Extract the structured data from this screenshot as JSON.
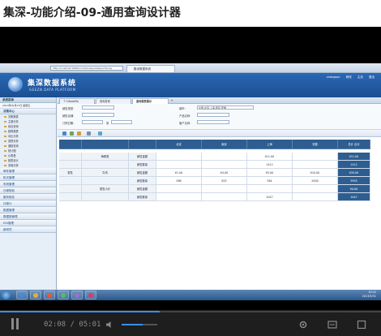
{
  "page": {
    "title": "集深-功能介绍-09-通用查询设计器"
  },
  "browser": {
    "address": "http://localhost:9000/modelAnalysis/ReportAnaly",
    "tab_label": "集深数据系统"
  },
  "app": {
    "logo_text": "集深数据系统",
    "logo_sub": "GEEZN DATA PLATFORM",
    "header_links": [
      "zhangsan",
      "修改",
      "主页",
      "退出"
    ]
  },
  "sidebar": {
    "header": "系统菜单",
    "date": "2013年05月27日 星期五",
    "section": "决策中心",
    "items": [
      "决策报表",
      "主题分析",
      "综合查询",
      "趋势报表",
      "对比分析",
      "透视分析",
      "通用查询",
      "统计图",
      "仪表盘",
      "报表设计",
      "多维分析"
    ],
    "menus": [
      "邮件管理",
      "机式管理",
      "系统管理",
      "日程规划",
      "服务报告",
      "日程计",
      "数据管理",
      "数据报管理",
      "EDI管理",
      "新研究"
    ]
  },
  "tabs": {
    "items": [
      "个人BookMa",
      "查询查询",
      "查询报表展示"
    ],
    "active_index": 2,
    "add": "+"
  },
  "filters": {
    "left_labels": [
      "销售类型：",
      "销售店铺：",
      "订购日期："
    ],
    "left_values": [
      "",
      "",
      ""
    ],
    "date_sep": "到",
    "right_labels": [
      "城市：",
      "产品名称：",
      "客户名称："
    ],
    "right_values": [
      "全国,北京,上海,南京,安徽",
      "",
      ""
    ]
  },
  "grid": {
    "header": [
      "",
      "",
      "",
      "北京",
      "南京",
      "上海",
      "安徽",
      "总计 合计"
    ],
    "rows": [
      {
        "c0": "",
        "c1": "海鲜类",
        "c2": "销售金额",
        "v": [
          "",
          "",
          "¥11.00",
          "",
          "¥11.00"
        ]
      },
      {
        "c0": "",
        "c1": "",
        "c2": "销售数量",
        "v": [
          "",
          "",
          "1412",
          "",
          "1412"
        ]
      },
      {
        "c0": "零售",
        "c1": "牛肉",
        "c2": "销售金额",
        "v": [
          "¥1.00",
          "¥4.00",
          "¥5.00",
          "¥10.00",
          "¥20.00"
        ]
      },
      {
        "c0": "",
        "c1": "",
        "c2": "销售数量",
        "v": [
          "586",
          "825",
          "584",
          "2000",
          "3995"
        ]
      },
      {
        "c0": "",
        "c1": "零售小计",
        "c2": "销售金额",
        "v": [
          "",
          "",
          "",
          "",
          "¥0.00"
        ]
      },
      {
        "c0": "",
        "c1": "",
        "c2": "销售数量",
        "v": [
          "",
          "",
          "1047",
          "",
          "1047"
        ]
      }
    ]
  },
  "taskbar": {
    "time": "10:22",
    "date": "2013/5/31"
  },
  "player": {
    "time": "02:08 / 05:01",
    "progress": 0.42,
    "volume": 0.6
  },
  "colors": {
    "header_blue": "#2a67b4",
    "grid_header": "#2e5e91",
    "progress": "#3a8ee6"
  }
}
